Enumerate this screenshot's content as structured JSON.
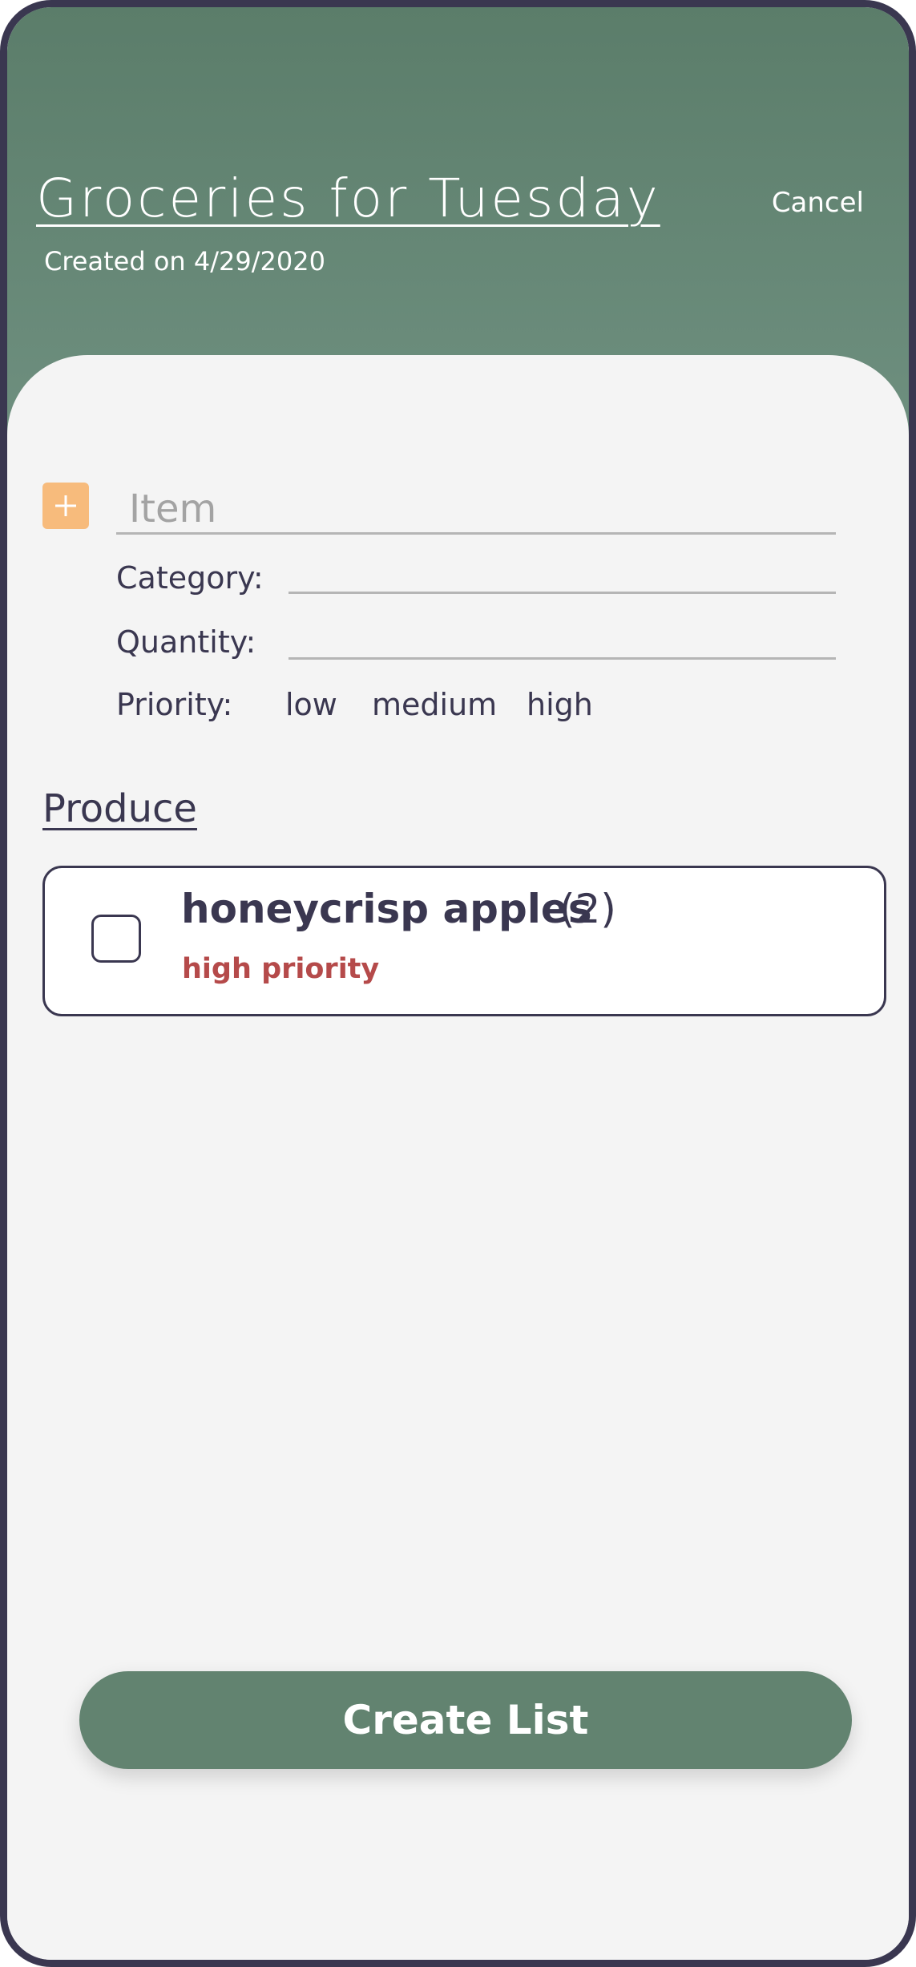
{
  "header": {
    "title": "Groceries for Tuesday",
    "subtitle": "Created on 4/29/2020",
    "cancel_label": "Cancel"
  },
  "form": {
    "add_icon": "plus-icon",
    "item_placeholder": "Item",
    "category_label": "Category:",
    "category_value": "",
    "quantity_label": "Quantity:",
    "quantity_value": "",
    "priority_label": "Priority:",
    "priority_options": [
      "low",
      "medium",
      "high"
    ]
  },
  "sections": [
    {
      "title": "Produce",
      "items": [
        {
          "name": "honeycrisp apples",
          "quantity": "(2)",
          "priority": "high priority",
          "checked": false
        }
      ]
    }
  ],
  "footer": {
    "create_label": "Create List"
  },
  "colors": {
    "header_green": "#5b7d6a",
    "button_green": "#628370",
    "accent_orange": "#f7bb7c",
    "text_dark": "#3a3750",
    "priority_red": "#b54a4a",
    "background": "#f4f4f4"
  }
}
